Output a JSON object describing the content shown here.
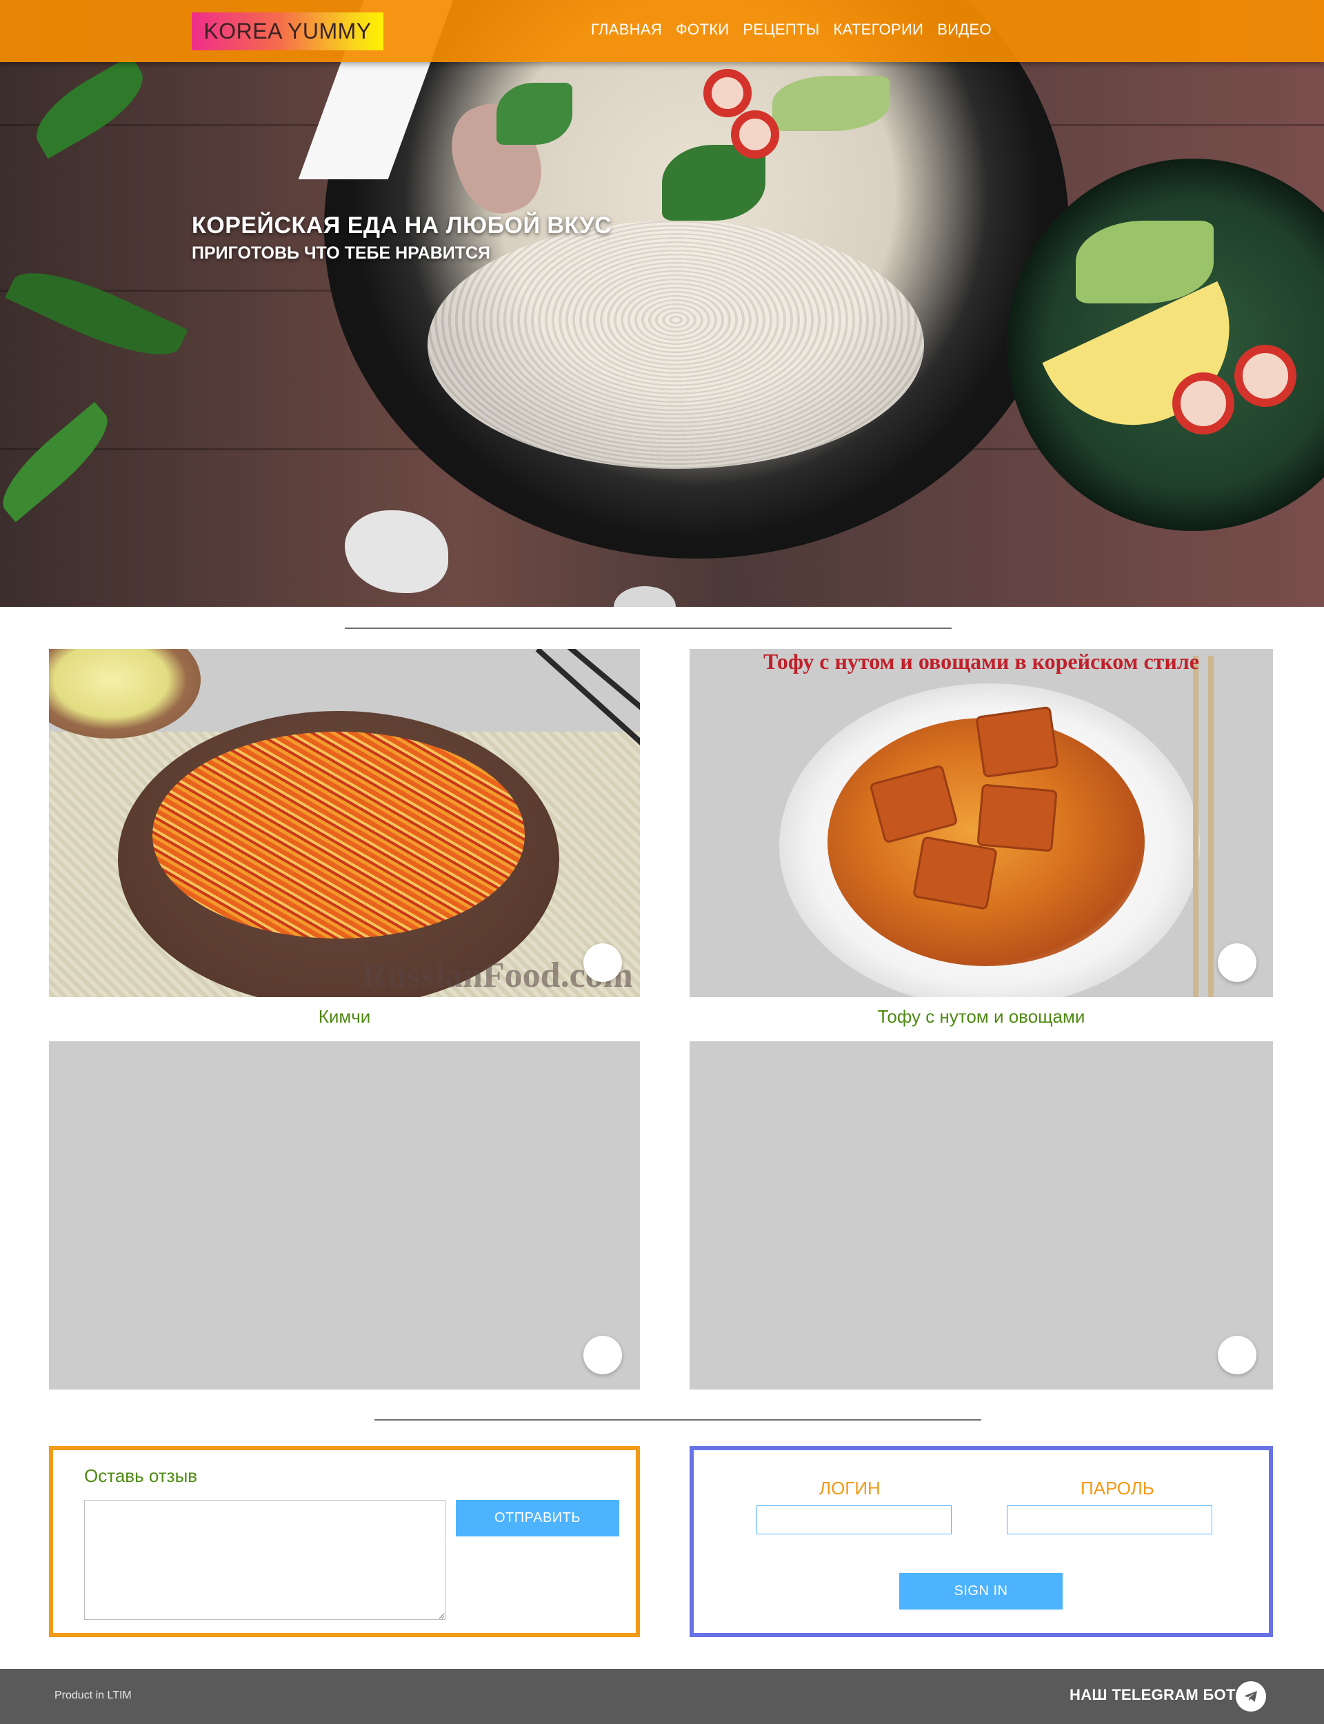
{
  "header": {
    "logo_text": "KOREA YUMMY",
    "nav": [
      "ГЛАВНАЯ",
      "ФОТКИ",
      "РЕЦЕПТЫ",
      "КАТЕГОРИИ",
      "ВИДЕО"
    ]
  },
  "hero": {
    "title": "КОРЕЙСКАЯ ЕДА НА ЛЮБОЙ ВКУС",
    "subtitle": "ПРИГОТОВЬ ЧТО ТЕБЕ НРАВИТСЯ"
  },
  "cards": [
    {
      "caption": "Кимчи",
      "image_watermark": "RussianFood.com"
    },
    {
      "caption": "Тофу с нутом и овощами",
      "image_banner": "Тофу с нутом и овощами в корейском стиле"
    },
    {
      "caption": ""
    },
    {
      "caption": ""
    }
  ],
  "review": {
    "label": "Оставь отзыв",
    "textarea_value": "",
    "submit_label": "ОТПРАВИТЬ"
  },
  "login": {
    "login_label": "ЛОГИН",
    "password_label": "ПАРОЛЬ",
    "login_value": "",
    "password_value": "",
    "signin_label": "SIGN IN"
  },
  "footer": {
    "credit": "Product in LTIM",
    "telegram_label": "НАШ TELEGRAM БОТ",
    "telegram_icon": "telegram-icon"
  },
  "colors": {
    "navbar": "#f58c00",
    "caption": "#4e8a12",
    "review_border": "#f39a16",
    "login_border": "#6772e5",
    "button": "#4db3ff",
    "footer": "#5a5a5a"
  }
}
